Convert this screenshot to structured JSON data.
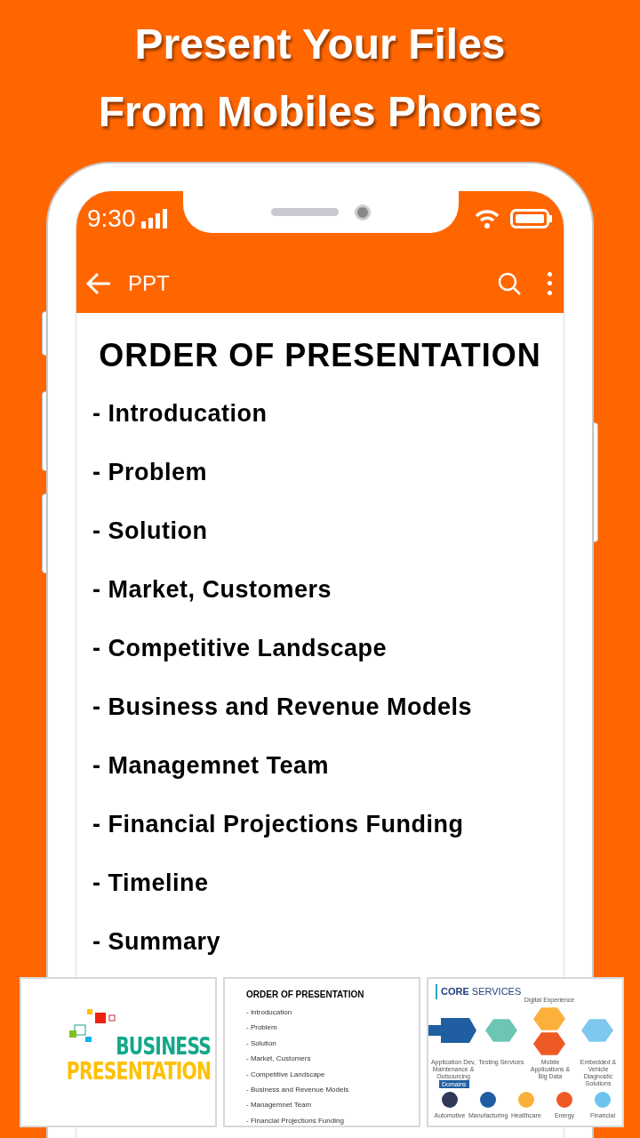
{
  "headline": [
    "Present Your Files",
    "From Mobiles Phones"
  ],
  "status_bar": {
    "time": "9:30"
  },
  "app_bar": {
    "title": "PPT"
  },
  "slide": {
    "title": "ORDER OF PRESENTATION",
    "items": [
      "- Introducation",
      "- Problem",
      "- Solution",
      "- Market, Customers",
      "- Competitive Landscape",
      "- Business and Revenue Models",
      "- Managemnet Team",
      "- Financial Projections Funding",
      "- Timeline",
      "- Summary"
    ]
  },
  "thumbnails": [
    {
      "kind": "title",
      "lines": [
        "BUSINESS",
        "PRESENTATION"
      ]
    },
    {
      "kind": "agenda",
      "title": "ORDER OF PRESENTATION",
      "items": [
        "- Introducation",
        "- Problem",
        "- Solution",
        "- Market, Customers",
        "- Competitive Landscape",
        "- Business and Revenue Models",
        "- Managemnet Team",
        "- Financial Projections Funding"
      ]
    },
    {
      "kind": "services",
      "title": "**CORE** SERVICES",
      "services": [
        "Application Dev, Maintenance & Outsourcing",
        "Testing Services",
        "Digital Experience",
        "Mobile Applications & Big Data",
        "Embedded & Vehicle Diagnostic Solutions"
      ],
      "domains_label": "Domains",
      "domains": [
        "Automotive",
        "Manufacturing",
        "Healthcare",
        "Energy",
        "Financial"
      ]
    }
  ]
}
